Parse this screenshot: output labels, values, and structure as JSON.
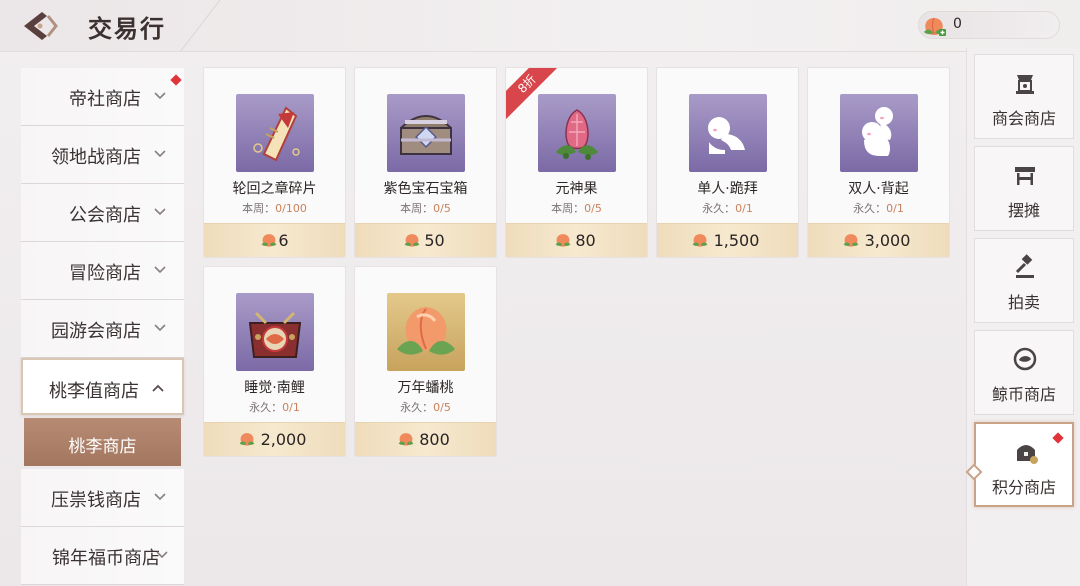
{
  "header": {
    "title": "交易行",
    "currency_value": "0"
  },
  "left_nav": {
    "items": [
      {
        "label": "帝社商店",
        "state": "collapsed",
        "badge": true
      },
      {
        "label": "领地战商店",
        "state": "collapsed",
        "badge": false
      },
      {
        "label": "公会商店",
        "state": "collapsed",
        "badge": false
      },
      {
        "label": "冒险商店",
        "state": "collapsed",
        "badge": false
      },
      {
        "label": "园游会商店",
        "state": "collapsed",
        "badge": false
      },
      {
        "label": "桃李值商店",
        "state": "expanded",
        "badge": false
      },
      {
        "label": "压祟钱商店",
        "state": "collapsed",
        "badge": false
      },
      {
        "label": "锦年福币商店",
        "state": "collapsed",
        "badge": false
      }
    ],
    "sub_item": {
      "label": "桃李商店",
      "selected": true
    }
  },
  "items": [
    {
      "name": "轮回之章碎片",
      "limit_prefix": "本周：",
      "limit": "0/100",
      "price": "6",
      "icon": "torn-page-icon",
      "discount": ""
    },
    {
      "name": "紫色宝石宝箱",
      "limit_prefix": "本周：",
      "limit": "0/5",
      "price": "50",
      "icon": "treasure-chest-icon",
      "discount": ""
    },
    {
      "name": "元神果",
      "limit_prefix": "本周：",
      "limit": "0/5",
      "price": "80",
      "icon": "fruit-icon",
      "discount": "8折"
    },
    {
      "name": "单人·跪拜",
      "limit_prefix": "永久：",
      "limit": "0/1",
      "price": "1,500",
      "icon": "kneel-emote-icon",
      "discount": ""
    },
    {
      "name": "双人·背起",
      "limit_prefix": "永久：",
      "limit": "0/1",
      "price": "3,000",
      "icon": "piggyback-emote-icon",
      "discount": ""
    },
    {
      "name": "睡觉·南鲤",
      "limit_prefix": "永久：",
      "limit": "0/1",
      "price": "2,000",
      "icon": "koi-bed-icon",
      "discount": ""
    },
    {
      "name": "万年蟠桃",
      "limit_prefix": "永久：",
      "limit": "0/5",
      "price": "800",
      "icon": "peach-icon",
      "discount": ""
    }
  ],
  "right_nav": {
    "tabs": [
      {
        "label": "商会商店",
        "icon": "merchant-hall-icon",
        "active": false,
        "badge": false
      },
      {
        "label": "摆摊",
        "icon": "stall-icon",
        "active": false,
        "badge": false
      },
      {
        "label": "拍卖",
        "icon": "gavel-icon",
        "active": false,
        "badge": false
      },
      {
        "label": "鲸币商店",
        "icon": "whale-coin-icon",
        "active": false,
        "badge": false
      },
      {
        "label": "积分商店",
        "icon": "points-chest-icon",
        "active": true,
        "badge": true
      }
    ]
  },
  "colors": {
    "accent": "#c9a387",
    "selected_sub": "#a37660",
    "price_bar": "#f6e9cf",
    "badge": "#e0343a",
    "item_bg_purple": "#8a7ab3",
    "item_bg_gold": "#d4b571"
  }
}
